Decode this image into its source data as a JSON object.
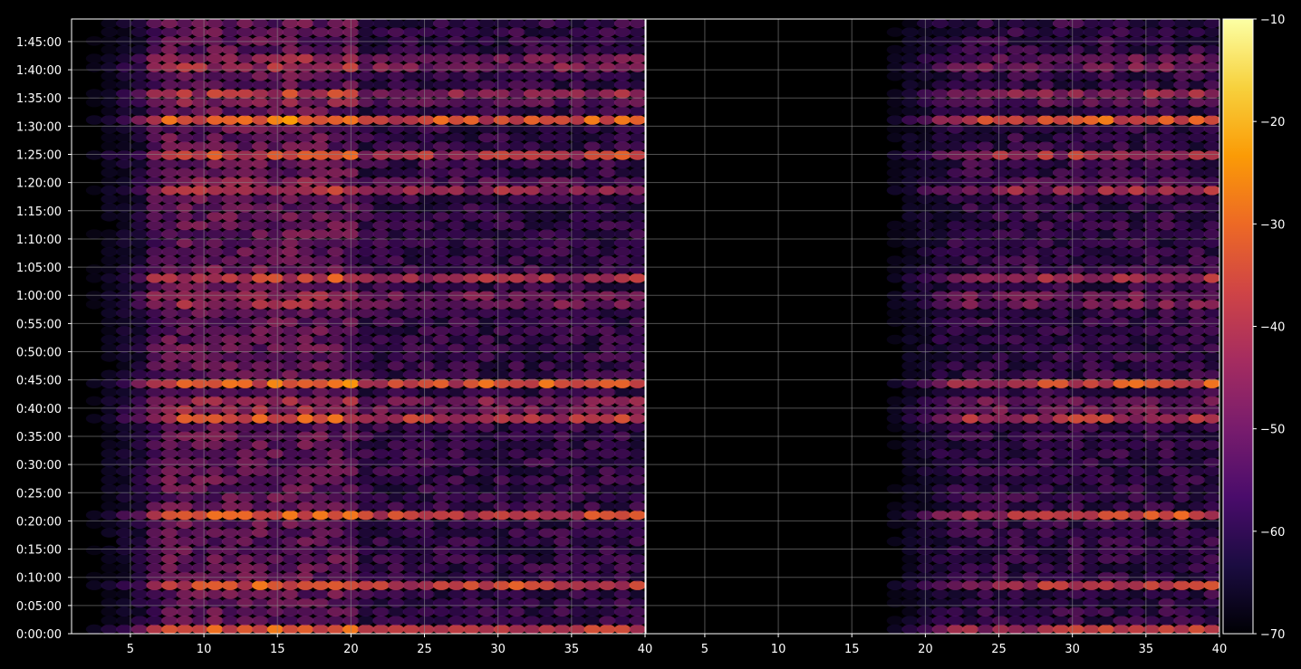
{
  "chart_data": [
    {
      "type": "heatmap",
      "title": "",
      "xlabel": "",
      "ylabel": "",
      "x_ticks": [
        "5",
        "10",
        "15",
        "20",
        "25",
        "30",
        "35",
        "40"
      ],
      "xlim": [
        1,
        40
      ],
      "y_ticks": [
        "0:00:00",
        "0:05:00",
        "0:10:00",
        "0:15:00",
        "0:20:00",
        "0:25:00",
        "0:30:00",
        "0:35:00",
        "0:40:00",
        "0:45:00",
        "0:50:00",
        "0:55:00",
        "1:00:00",
        "1:05:00",
        "1:10:00",
        "1:15:00",
        "1:20:00",
        "1:25:00",
        "1:30:00",
        "1:35:00",
        "1:40:00",
        "1:45:00"
      ],
      "ylim_seconds": [
        0,
        6540
      ],
      "grid": true,
      "colormap": "inferno",
      "x_active_range": [
        2,
        40
      ],
      "bright_rows_seconds": [
        30,
        530,
        1250,
        2310,
        2430,
        2670,
        3550,
        3810,
        4750,
        5070,
        5470,
        5710,
        6070
      ],
      "peak_level_db": -18
    },
    {
      "type": "heatmap",
      "title": "",
      "xlabel": "",
      "ylabel": "",
      "x_ticks": [
        "5",
        "10",
        "15",
        "20",
        "25",
        "30",
        "35",
        "40"
      ],
      "xlim": [
        1,
        40
      ],
      "y_ticks": [],
      "grid": true,
      "colormap": "inferno",
      "x_active_range": [
        17,
        40
      ],
      "bright_rows_seconds": [
        30,
        530,
        1250,
        2310,
        2430,
        2670,
        3550,
        3810,
        4750,
        5070,
        5470,
        5710,
        6070
      ],
      "peak_level_db": -20
    }
  ],
  "colorbar": {
    "ticks": [
      "−10",
      "−20",
      "−30",
      "−40",
      "−50",
      "−60",
      "−70"
    ],
    "range": [
      -70,
      -10
    ],
    "colors": [
      "#000004",
      "#1b0c41",
      "#4a0c6b",
      "#781c6d",
      "#a52c60",
      "#cf4446",
      "#ed6925",
      "#fb9b06",
      "#f7d13d",
      "#fcffa4"
    ]
  },
  "style": {
    "background": "#000000",
    "axis_color": "#ffffff",
    "grid_color": "#888888"
  }
}
